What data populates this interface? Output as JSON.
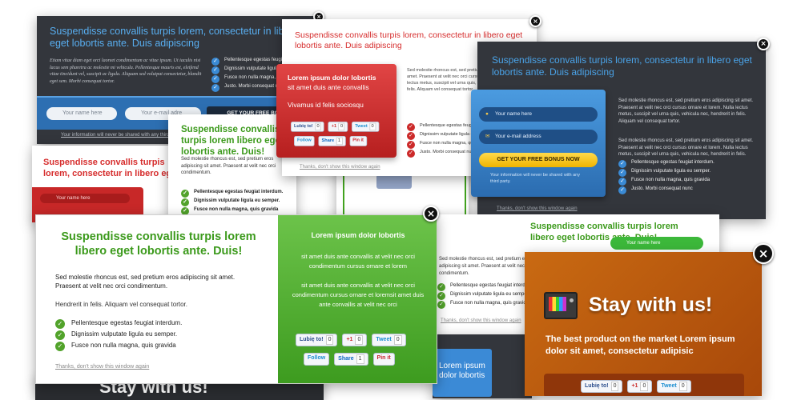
{
  "headline": "Suspendisse convallis turpis lorem, consectetur in libero eget lobortis ante. Duis adipiscing",
  "headline_short": "Suspendisse convallis turpis lorem, consectetur in libero eget lobortis ante. Duis adipiscing",
  "green_headline": "Suspendisse convallis turpis lorem libero eget lobortis ante. Duis!",
  "body_text": "Etiam vitae diam eget orci laoreet condimentum ac vitae ipsum. Ut iaculis nisi lacus sem pharetra ac molestie mi vehicula. Pellentesque mauris est, eleifend vitae tincidunt vel, suscipit ac ligula. Aliquam sed volutpat consectetur, blandit eget sem. Morbi consequat tortor.",
  "main_text_1": "Sed molestie rhoncus est, sed pretium eros adipiscing sit amet. Praesent at velit nec orci condimentum.",
  "main_text_2": "Hendrerit in felis. Aliquam vel consequat tortor.",
  "dark_text_1": "Sed molestie rhoncus est, sed pretium eros adipiscing sit amet. Praesent at velit nec orci cursus ornare et lorem. Nulla lectus metus, suscipit vel urna quis, vehicula nec, hendrerit in felis. Aliquam vel consequat tortor.",
  "dark_text_2": "Sed molestie rhoncus est, sed pretium eros adipiscing sit amet. Praesent at velit nec orci cursus ornare et lorem. Nulla lectus metus, suscipit vel urna quis, vehicula nec, hendrerit in felis.",
  "list": [
    "Pellentesque egestas feugiat interdum.",
    "Dignissim vulputate ligula eu semper.",
    "Fusce non nulla magna, quis gravida",
    "Justo. Morbi consequat nunc"
  ],
  "list_short": [
    "Pellentesque egestas feugiat interdum.",
    "Dignissim vulputate ligula eu semper.",
    "Fusce non nulla magna, quis gravida"
  ],
  "list_short2": [
    "Pellentesque egestas feugiat interdum.",
    "Dignissim vulputate ligula eu semper.",
    "Fusce non nulla magna, quis gravida",
    "Justo. Morbi consequat nunc"
  ],
  "dismiss": "Thanks, don't show this window again",
  "name_placeholder": "Your name here",
  "email_placeholder": "Your e-mail address",
  "email_short": "Your e-mail adre",
  "bonus_button": "GET YOUR FREE BONUS NOW",
  "bonus_short": "GET YOUR FREE BON",
  "privacy": "Your information will never be shared with any third party.",
  "privacy_short": "Your information will never be shared with any third party.",
  "red_box": {
    "title": "Lorem ipsum dolor lobortis",
    "sub": "sit amet duis ante convallis",
    "line": "Vivamus id felis sociosqu"
  },
  "green_box": {
    "title": "Lorem ipsum dolor lobortis",
    "p1": "sit amet duis ante convallis at velit nec orci condimentum cursus ornare et lorem",
    "p2": "sit amet duis ante convallis at velit nec orci condimentum cursus ornare et loremsit amet duis ante convallis at velit nec orci"
  },
  "social": {
    "like": "Lubię to!",
    "like_count": "0",
    "plus": "+1",
    "plus_count": "0",
    "tweet": "Tweet",
    "tweet_count": "0",
    "follow": "Follow",
    "share": "Share",
    "share_count": "1",
    "pin": "Pin it"
  },
  "stay": {
    "title": "Stay with us!",
    "text": "The best product on the market Lorem ipsum dolor sit amet, consectetur adipisic"
  },
  "bottom_fragment": "Stay with us!",
  "bottom_blue": "Lorem ipsum dolor lobortis sit amet duis ante convallis",
  "colors": {
    "green": "#3c9a1c",
    "red": "#d32b2b",
    "blue_title": "#4aa3e8",
    "orange": "#c9630d",
    "dark": "#2f3237"
  }
}
